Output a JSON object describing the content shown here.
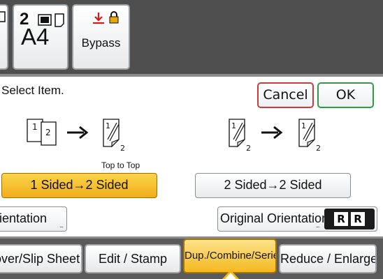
{
  "trays": {
    "tray2": {
      "number": "2",
      "paper_size": "A4"
    },
    "bypass": {
      "label": "Bypass"
    }
  },
  "dialog": {
    "title": "Select Item.",
    "cancel_label": "Cancel",
    "ok_label": "OK",
    "diagram_left": {
      "page1": "1",
      "page2": "2",
      "result_page": "1",
      "result_back": "2"
    },
    "diagram_right": {
      "source_page": "1",
      "source_back": "2",
      "result_page": "1",
      "result_back": "2"
    },
    "top_to_top_label": "Top to Top",
    "options": [
      {
        "label": "1 Sided→2 Sided",
        "selected": true
      },
      {
        "label": "2 Sided→2 Sided",
        "selected": false
      }
    ],
    "orientation_left_label": "rientation",
    "orientation_right_label": "Original Orientation",
    "orientation_icon_letter": "R",
    "more_dots": "..."
  },
  "tabs": [
    {
      "label": "over/Slip Sheet",
      "active": false
    },
    {
      "label": "Edit / Stamp",
      "active": false
    },
    {
      "label": "Dup./Combine/Series",
      "active": true
    },
    {
      "label": "Reduce / Enlarge",
      "active": false
    }
  ],
  "colors": {
    "selected_option": "#f1ad1a",
    "cancel_border": "#c83c3c",
    "ok_border": "#2f9a4a",
    "bypass_icon": "#d01818",
    "lock_icon": "#e8a800"
  },
  "icons": {
    "tray": "paper-tray-icon",
    "bypass_feed": "bypass-feed-icon",
    "lock": "lock-icon",
    "arrow": "arrow-right-icon",
    "orientation": "orientation-r-icon"
  }
}
